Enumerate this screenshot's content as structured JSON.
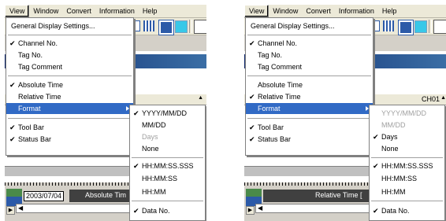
{
  "menubar": {
    "items": [
      "View",
      "Window",
      "Convert",
      "Information",
      "Help"
    ]
  },
  "view_menu": {
    "general_display": "General Display Settings...",
    "channel_no": "Channel No.",
    "tag_no": "Tag No.",
    "tag_comment": "Tag Comment",
    "absolute_time": "Absolute Time",
    "relative_time": "Relative Time",
    "format": "Format",
    "tool_bar": "Tool Bar",
    "status_bar": "Status Bar"
  },
  "format_menu": {
    "yyyy": "YYYY/MM/DD",
    "mmdd": "MM/DD",
    "days": "Days",
    "none": "None",
    "hhmmss_sss": "HH:MM:SS.SSS",
    "hhmmss": "HH:MM:SS",
    "hhmm": "HH:MM",
    "data_no": "Data No."
  },
  "left_pane": {
    "timestamp": "2003/07/04 16:05",
    "bottom_date": "2003/07/04",
    "bottom_label": "Absolute Tim",
    "checked": {
      "channel_no": true,
      "tag_no": false,
      "tag_comment": false,
      "absolute_time": true,
      "relative_time": false,
      "tool_bar": true,
      "status_bar": true,
      "yyyy": true,
      "mmdd": false,
      "days": false,
      "none": false,
      "hhmmss_sss": true,
      "hhmmss": false,
      "hhmm": false,
      "data_no": true
    }
  },
  "right_pane": {
    "channel_header": "CH01",
    "timestamp": "0 00:00:19.400[00",
    "bottom_label": "Relative Time [",
    "checked": {
      "channel_no": true,
      "tag_no": false,
      "tag_comment": false,
      "absolute_time": false,
      "relative_time": true,
      "tool_bar": true,
      "status_bar": true,
      "yyyy": false,
      "mmdd": false,
      "days": true,
      "none": false,
      "hhmmss_sss": true,
      "hhmmss": false,
      "hhmm": false,
      "data_no": true
    }
  },
  "icons": {
    "checkmark": "✔",
    "submenu_arrow": "triangle-right",
    "scroll_left": "◀",
    "scroll_right": "▶",
    "sort_up": "▲"
  },
  "colors": {
    "menu_highlight": "#316ac5",
    "menubar_bg": "#ece9d8",
    "disabled_text": "#a0a0a0"
  }
}
